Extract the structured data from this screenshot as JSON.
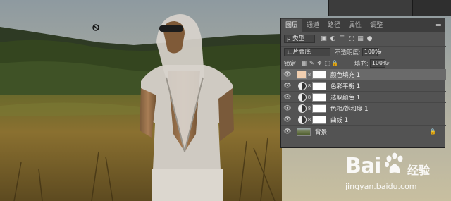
{
  "tabs": [
    "图层",
    "通道",
    "路径",
    "属性",
    "调整"
  ],
  "active_tab": 0,
  "filter": {
    "type_label": "ρ 类型",
    "icons": [
      "image-filter-icon",
      "adjustment-filter-icon",
      "type-filter-icon",
      "shape-filter-icon",
      "smart-object-filter-icon",
      "filter-toggle-icon"
    ]
  },
  "blend": {
    "mode": "正片叠底",
    "opacity_label": "不透明度:",
    "opacity": "100%"
  },
  "lock": {
    "label": "锁定:",
    "fill_label": "填充:",
    "fill": "100%"
  },
  "layers": [
    {
      "name": "颜色填充 1",
      "kind": "fill",
      "swatch": "#f2cfb0",
      "selected": true
    },
    {
      "name": "色彩平衡 1",
      "kind": "adjustment",
      "selected": false
    },
    {
      "name": "选取颜色 1",
      "kind": "adjustment",
      "selected": false
    },
    {
      "name": "色相/饱和度 1",
      "kind": "adjustment",
      "selected": false
    },
    {
      "name": "曲线 1",
      "kind": "adjustment",
      "selected": false
    },
    {
      "name": "背景",
      "kind": "background",
      "selected": false
    }
  ],
  "watermark": {
    "logo": "Bai",
    "cn": "经验",
    "url": "jingyan.baidu.com"
  },
  "colors": {
    "panel": "#535353",
    "tabbar": "#3d3d3d",
    "selected_row": "#6a6a6a",
    "fill_swatch": "#f2cfb0"
  }
}
